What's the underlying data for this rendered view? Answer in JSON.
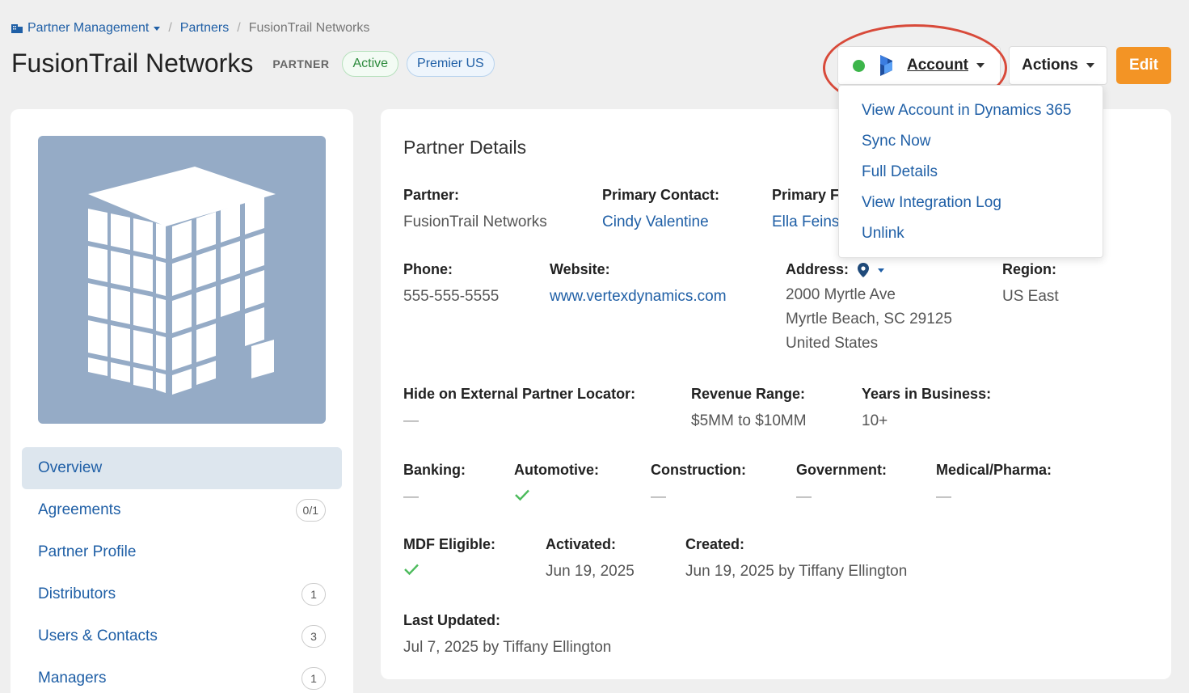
{
  "breadcrumb": {
    "root": "Partner Management",
    "parent": "Partners",
    "current": "FusionTrail Networks"
  },
  "header": {
    "title": "FusionTrail Networks",
    "type_tag": "PARTNER",
    "status_badge": "Active",
    "tier_badge": "Premier US",
    "account_label": "Account",
    "actions_label": "Actions",
    "edit_label": "Edit"
  },
  "account_menu": {
    "items": [
      "View Account in Dynamics 365",
      "Sync Now",
      "Full Details",
      "View Integration Log",
      "Unlink"
    ]
  },
  "side_nav": {
    "items": [
      {
        "label": "Overview",
        "count": ""
      },
      {
        "label": "Agreements",
        "count": "0/1"
      },
      {
        "label": "Partner Profile",
        "count": ""
      },
      {
        "label": "Distributors",
        "count": "1"
      },
      {
        "label": "Users & Contacts",
        "count": "3"
      },
      {
        "label": "Managers",
        "count": "1"
      }
    ]
  },
  "details": {
    "section_title": "Partner Details",
    "partner": {
      "label": "Partner:",
      "value": "FusionTrail Networks"
    },
    "primary_contact": {
      "label": "Primary Contact:",
      "value": "Cindy Valentine"
    },
    "primary_other": {
      "label": "Primary F",
      "value": "Ella Feins"
    },
    "phone": {
      "label": "Phone:",
      "value": "555-555-5555"
    },
    "website": {
      "label": "Website:",
      "value": "www.vertexdynamics.com"
    },
    "address": {
      "label": "Address:",
      "line1": "2000 Myrtle Ave",
      "line2": "Myrtle Beach, SC 29125",
      "line3": "United States"
    },
    "region": {
      "label": "Region:",
      "value": "US East"
    },
    "hide_locator": {
      "label": "Hide on External Partner Locator:",
      "value": "—"
    },
    "revenue": {
      "label": "Revenue Range:",
      "value": "$5MM to $10MM"
    },
    "years": {
      "label": "Years in Business:",
      "value": "10+"
    },
    "banking": {
      "label": "Banking:",
      "value": "—"
    },
    "automotive": {
      "label": "Automotive:"
    },
    "construction": {
      "label": "Construction:",
      "value": "—"
    },
    "government": {
      "label": "Government:",
      "value": "—"
    },
    "medical": {
      "label": "Medical/Pharma:",
      "value": "—"
    },
    "mdf": {
      "label": "MDF Eligible:"
    },
    "activated": {
      "label": "Activated:",
      "value": "Jun 19, 2025"
    },
    "created": {
      "label": "Created:",
      "value": "Jun 19, 2025 by Tiffany Ellington"
    },
    "last_updated": {
      "label": "Last Updated:",
      "value": "Jul 7, 2025 by Tiffany Ellington"
    }
  },
  "colors": {
    "link": "#1f5fa6",
    "accent_orange": "#f39425",
    "status_green": "#3cb54a",
    "highlight_red": "#d84a3a",
    "logo_bg": "#95abc6"
  }
}
